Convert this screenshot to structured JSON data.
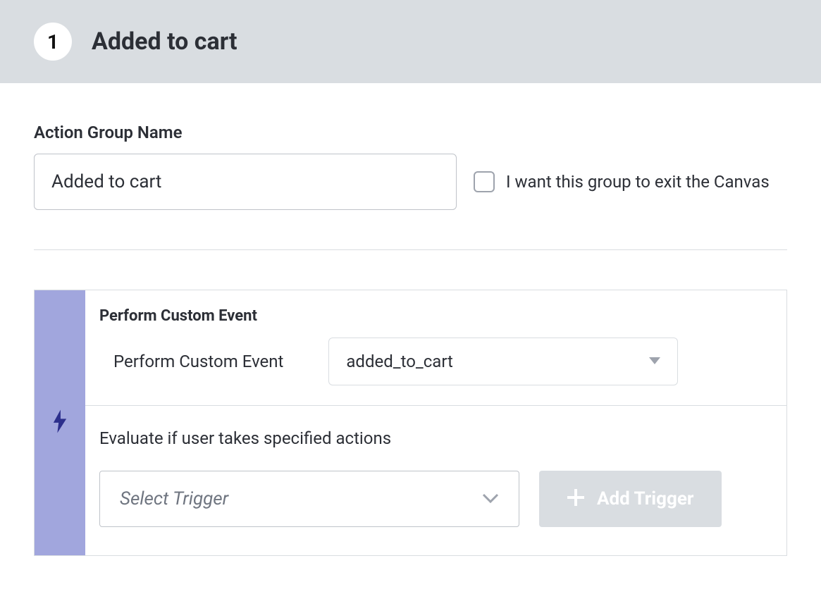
{
  "header": {
    "step_number": "1",
    "title": "Added to cart"
  },
  "form": {
    "name_label": "Action Group Name",
    "name_value": "Added to cart",
    "exit_checkbox_label": "I want this group to exit the Canvas"
  },
  "event_panel": {
    "heading": "Perform Custom Event",
    "row_label": "Perform Custom Event",
    "selected_event": "added_to_cart",
    "evaluate_heading": "Evaluate if user takes specified actions",
    "trigger_placeholder": "Select Trigger",
    "add_trigger_label": "Add Trigger"
  }
}
